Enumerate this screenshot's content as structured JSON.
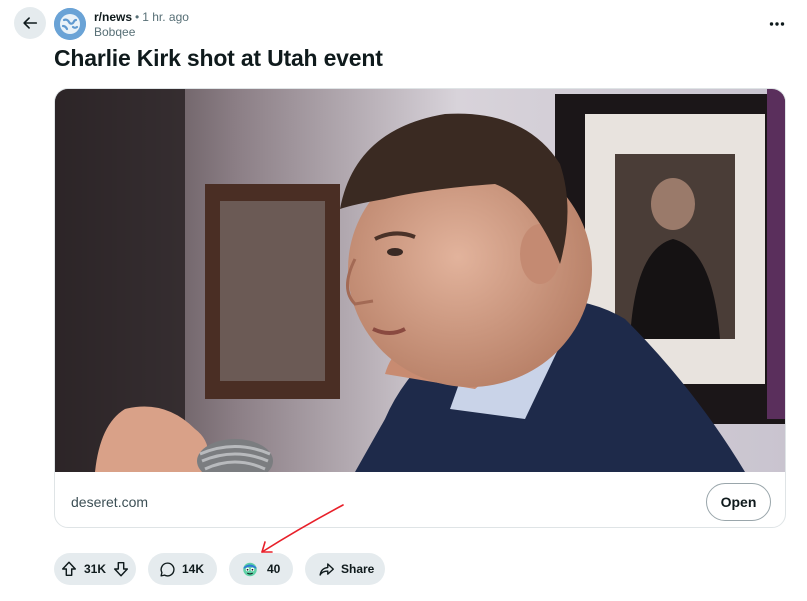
{
  "header": {
    "subreddit": "r/news",
    "separator": "•",
    "time_ago": "1 hr. ago",
    "author": "Bobqee"
  },
  "post": {
    "title": "Charlie Kirk shot at Utah event"
  },
  "link_card": {
    "domain": "deseret.com",
    "open_label": "Open"
  },
  "actions": {
    "score": "31K",
    "comments": "14K",
    "awards": "40",
    "share_label": "Share"
  },
  "icons": {
    "back": "arrow-left-icon",
    "more": "more-horizontal-icon",
    "upvote": "upvote-arrow-icon",
    "downvote": "downvote-arrow-icon",
    "comment": "speech-bubble-icon",
    "award": "award-emoji-icon",
    "share": "share-arrow-icon"
  },
  "colors": {
    "pill_bg": "#e5ebee",
    "annotation": "#e8202a",
    "avatar": "#5f99cf"
  }
}
